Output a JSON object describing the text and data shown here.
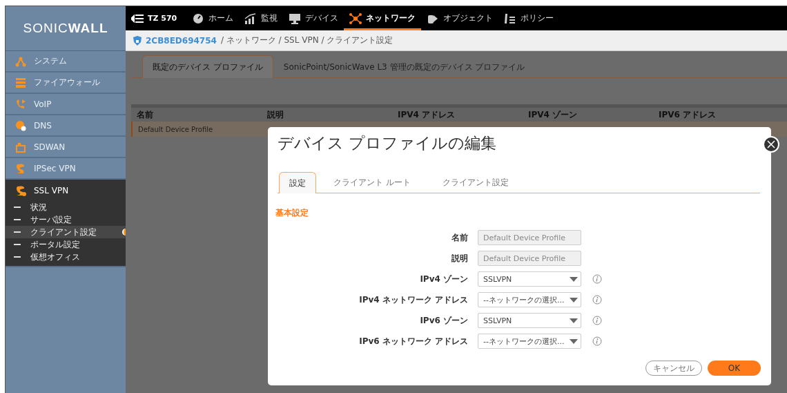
{
  "brand": {
    "logo": "SONIC**WALL**"
  },
  "topbar": {
    "device": "TZ 570",
    "nav": [
      {
        "label": "ホーム",
        "selected": false
      },
      {
        "label": "監視",
        "selected": false
      },
      {
        "label": "デバイス",
        "selected": false
      },
      {
        "label": "ネットワーク",
        "selected": true
      },
      {
        "label": "オブジェクト",
        "selected": false
      },
      {
        "label": "ポリシー",
        "selected": false
      }
    ]
  },
  "breadcrumb": {
    "device_id": "2CB8ED694754",
    "path": "/ ネットワーク / SSL VPN / クライアント設定"
  },
  "sidebar": {
    "items": [
      {
        "label": "システム",
        "expanded": false
      },
      {
        "label": "ファイアウォール",
        "expanded": false
      },
      {
        "label": "VoIP",
        "expanded": false
      },
      {
        "label": "DNS",
        "expanded": false
      },
      {
        "label": "SDWAN",
        "expanded": false
      },
      {
        "label": "IPSec VPN",
        "expanded": false
      },
      {
        "label": "SSL VPN",
        "expanded": true,
        "children": [
          {
            "label": "状況",
            "selected": false
          },
          {
            "label": "サーバ設定",
            "selected": false
          },
          {
            "label": "クライアント設定",
            "selected": true
          },
          {
            "label": "ポータル設定",
            "selected": false
          },
          {
            "label": "仮想オフィス",
            "selected": false
          }
        ]
      }
    ]
  },
  "page_tabs": [
    {
      "label": "既定のデバイス プロファイル",
      "selected": true
    },
    {
      "label": "SonicPoint/SonicWave L3 管理の既定のデバイス プロファイル",
      "selected": false
    }
  ],
  "table": {
    "columns": [
      "名前",
      "説明",
      "IPV4 アドレス",
      "IPV4 ゾーン",
      "IPV6 アドレス"
    ],
    "rows": [
      {
        "name": "Default Device Profile",
        "selected": true
      }
    ]
  },
  "dialog": {
    "title": "デバイス プロファイルの編集",
    "tabs": [
      {
        "label": "設定",
        "selected": true
      },
      {
        "label": "クライアント ルート",
        "selected": false
      },
      {
        "label": "クライアント設定",
        "selected": false
      }
    ],
    "section": "基本設定",
    "fields": [
      {
        "label": "名前",
        "kind": "text",
        "value": "Default Device Profile",
        "disabled": true
      },
      {
        "label": "説明",
        "kind": "text",
        "value": "Default Device Profile",
        "disabled": true
      },
      {
        "label": "IPv4 ゾーン",
        "kind": "select",
        "value": "SSLVPN",
        "disabled": false
      },
      {
        "label": "IPv4 ネットワーク アドレス",
        "kind": "select",
        "value": "--ネットワークの選択...",
        "disabled": false
      },
      {
        "label": "IPv6 ゾーン",
        "kind": "select",
        "value": "SSLVPN",
        "disabled": false
      },
      {
        "label": "IPv6 ネットワーク アドレス",
        "kind": "select",
        "value": "--ネットワークの選択...",
        "disabled": false
      }
    ],
    "buttons": [
      {
        "label": "キャンセル",
        "kind": "secondary"
      },
      {
        "label": "OK",
        "kind": "primary"
      }
    ]
  }
}
